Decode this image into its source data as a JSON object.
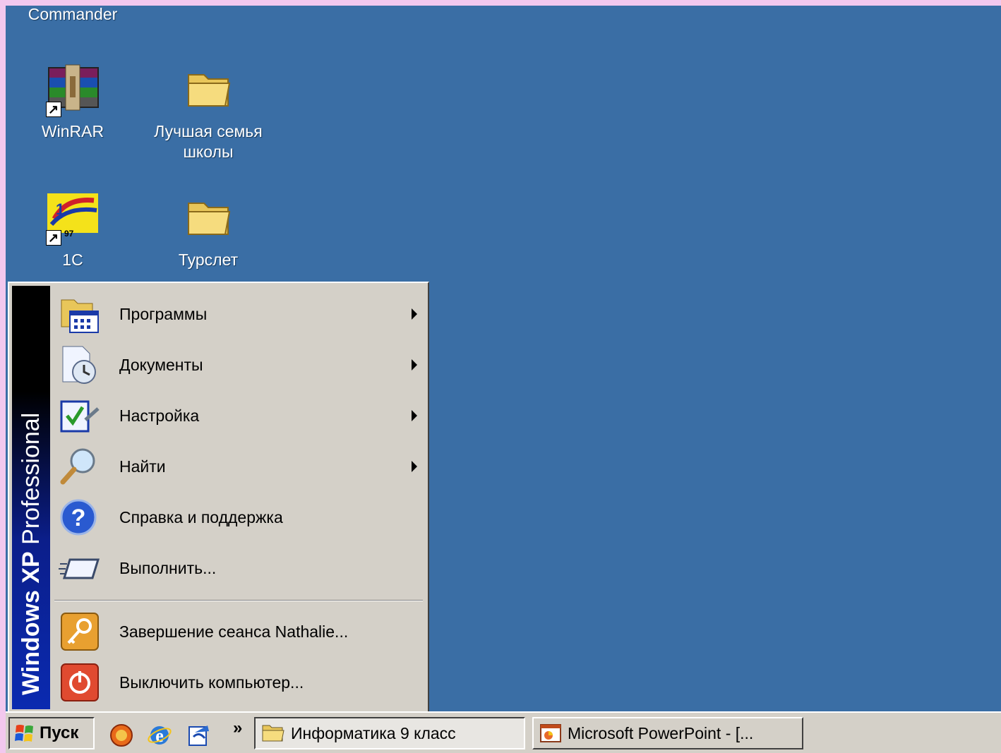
{
  "desktop": {
    "icons": [
      {
        "label": "Commander",
        "icon": "total-commander-icon"
      },
      {
        "label": "WinRAR",
        "icon": "winrar-icon"
      },
      {
        "label": "Лучшая семья школы",
        "icon": "folder-icon"
      },
      {
        "label": "1С",
        "icon": "1c-icon",
        "badge": "97"
      },
      {
        "label": "Турслет",
        "icon": "folder-icon"
      }
    ]
  },
  "start_menu": {
    "sidebar_bold": "Windows XP",
    "sidebar_text": "Professional",
    "items": [
      {
        "label": "Программы",
        "icon": "programs-icon",
        "submenu": true
      },
      {
        "label": "Документы",
        "icon": "documents-icon",
        "submenu": true
      },
      {
        "label": "Настройка",
        "icon": "settings-icon",
        "submenu": true
      },
      {
        "label": "Найти",
        "icon": "search-icon",
        "submenu": true
      },
      {
        "label": "Справка и поддержка",
        "icon": "help-icon",
        "submenu": false
      },
      {
        "label": "Выполнить...",
        "icon": "run-icon",
        "submenu": false
      },
      {
        "label": "Завершение сеанса Nathalie...",
        "icon": "logoff-icon",
        "submenu": false
      },
      {
        "label": "Выключить компьютер...",
        "icon": "shutdown-icon",
        "submenu": false
      }
    ]
  },
  "taskbar": {
    "start_label": "Пуск",
    "quicklaunch_more": "»",
    "tasks": [
      {
        "label": "Информатика 9 класс",
        "icon": "folder-icon",
        "active": true
      },
      {
        "label": "Microsoft PowerPoint - [...",
        "icon": "powerpoint-icon",
        "active": false
      }
    ]
  },
  "colors": {
    "desktop": "#3a6ea5",
    "menu": "#d4d0c8",
    "page_border": "#f2c8ee"
  }
}
